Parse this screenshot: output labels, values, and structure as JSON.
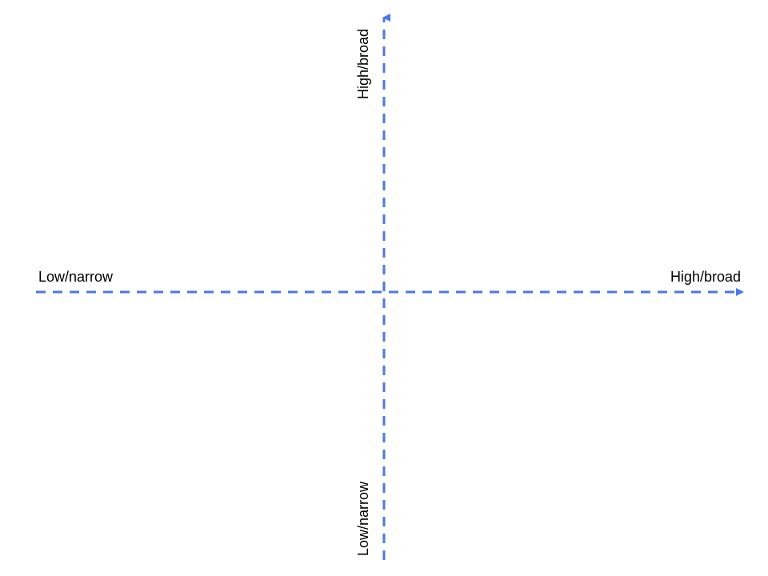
{
  "chart_data": {
    "type": "diagram",
    "subtype": "quadrant-axes",
    "axes": {
      "x": {
        "left_label": "Low/narrow",
        "right_label": "High/broad"
      },
      "y": {
        "top_label": "High/broad",
        "bottom_label": "Low/narrow"
      }
    },
    "axis_style": {
      "color": "#4a77ef",
      "dash": "dashed",
      "arrowheads": [
        "right",
        "up"
      ]
    }
  }
}
